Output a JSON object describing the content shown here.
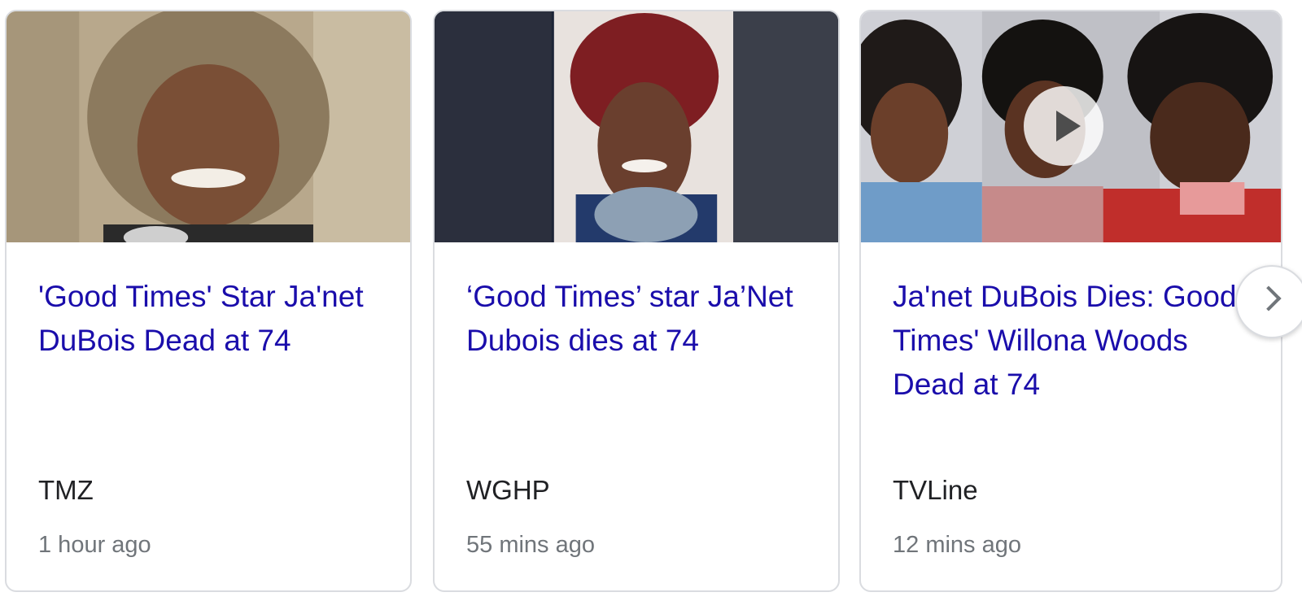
{
  "cards": [
    {
      "headline": "'Good Times' Star Ja'net DuBois Dead at 74",
      "source": "TMZ",
      "time": "1 hour ago",
      "has_video": false
    },
    {
      "headline": "‘Good Times’ star Ja’Net Dubois dies at 74",
      "source": "WGHP",
      "time": "55 mins ago",
      "has_video": false
    },
    {
      "headline": "Ja'net DuBois Dies: Good Times' Willona Woods Dead at 74",
      "source": "TVLine",
      "time": "12 mins ago",
      "has_video": true
    }
  ],
  "colors": {
    "link": "#1a0dab",
    "source": "#202124",
    "meta": "#70757a",
    "border": "#dadce0"
  },
  "icons": {
    "play": "play-icon",
    "next": "chevron-right-icon"
  }
}
